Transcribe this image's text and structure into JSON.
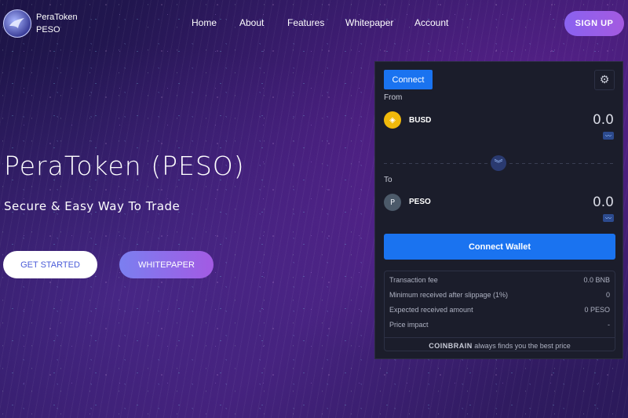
{
  "brand": {
    "name": "PeraToken",
    "ticker": "PESO",
    "logo_icon": "bird-icon"
  },
  "nav": {
    "items": [
      "Home",
      "About",
      "Features",
      "Whitepaper",
      "Account"
    ],
    "signup": "SIGN UP"
  },
  "hero": {
    "title": "PeraToken (PESO)",
    "subtitle": "Secure & Easy Way To Trade",
    "btn_start": "GET STARTED",
    "btn_whitepaper": "WHITEPAPER"
  },
  "swap": {
    "connect_label": "Connect",
    "settings_icon": "gear-icon",
    "from": {
      "label": "From",
      "token": "BUSD",
      "amount": "0.0",
      "icon": "busd-icon"
    },
    "to": {
      "label": "To",
      "token": "PESO",
      "icon_letter": "P",
      "amount": "0.0"
    },
    "switch_icon": "double-chevron-down-icon",
    "connect_wallet": "Connect Wallet",
    "details": [
      {
        "label": "Transaction fee",
        "value": "0.0 BNB"
      },
      {
        "label": "Minimum received after slippage (1%)",
        "value": "0"
      },
      {
        "label": "Expected received amount",
        "value": "0 PESO"
      },
      {
        "label": "Price impact",
        "value": "-"
      }
    ],
    "footer_brand": "COINBRAIN",
    "footer_text": "always finds you the best price"
  },
  "colors": {
    "accent": "#1a73f0",
    "signup_gradient_start": "#8a62f0",
    "panel_bg": "#1b1d2b"
  }
}
